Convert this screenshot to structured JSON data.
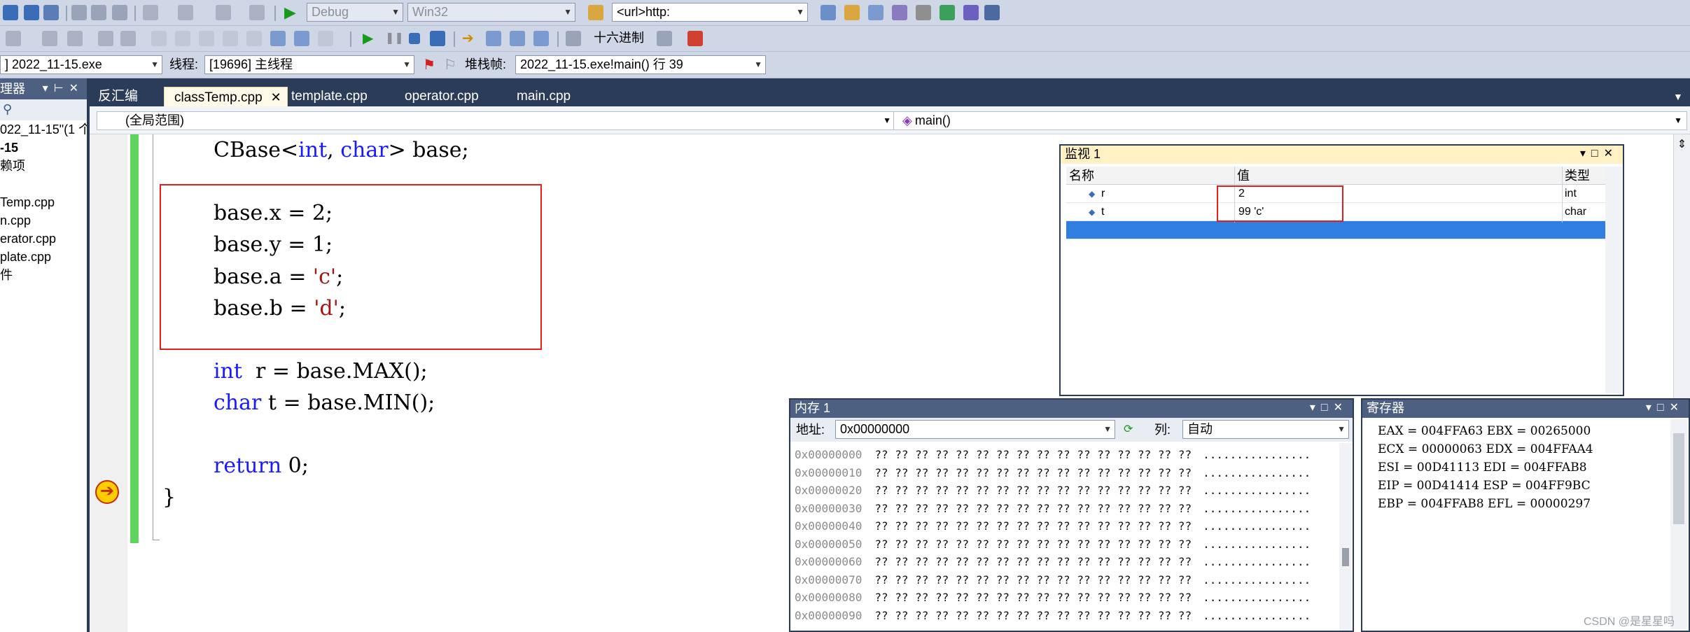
{
  "toolbar1": {
    "config": "Debug",
    "platform": "Win32",
    "url": "<url>http:"
  },
  "toolbar2": {
    "hex_label": "十六进制"
  },
  "toolbar3": {
    "process": "] 2022_11-15.exe",
    "thread_label": "线程:",
    "thread": "[19696] 主线程",
    "stack_label": "堆栈帧:",
    "stack_frame": "2022_11-15.exe!main() 行 39"
  },
  "solution": {
    "title": "理器",
    "items": [
      "022_11-15\"(1 个",
      "-15",
      "赖项",
      "",
      "Temp.cpp",
      "n.cpp",
      "erator.cpp",
      "plate.cpp",
      "件"
    ]
  },
  "tabs": [
    "反汇编",
    "classTemp.cpp",
    "template.cpp",
    "operator.cpp",
    "main.cpp"
  ],
  "navbar": {
    "scope": "(全局范围)",
    "function": "main()"
  },
  "code": {
    "l1_a": "CBase<",
    "l1_kw1": "int",
    "l1_b": ", ",
    "l1_kw2": "char",
    "l1_c": "> base;",
    "l2": "base.x = 2;",
    "l3": "base.y = 1;",
    "l4_a": "base.a = ",
    "l4_s": "'c'",
    "l4_b": ";",
    "l5_a": "base.b = ",
    "l5_s": "'d'",
    "l5_b": ";",
    "l6_kw": "int",
    "l6_b": "  r = base.MAX();",
    "l7_kw": "char",
    "l7_b": " t = base.MIN();",
    "l8_kw": "return",
    "l8_b": " 0;",
    "l9": "}"
  },
  "watch": {
    "title": "监视 1",
    "col_name": "名称",
    "col_value": "值",
    "col_type": "类型",
    "rows": [
      {
        "name": "r",
        "value": "2",
        "type": "int"
      },
      {
        "name": "t",
        "value": "99 'c'",
        "type": "char"
      }
    ]
  },
  "memory": {
    "title": "内存 1",
    "addr_label": "地址:",
    "addr": "0x00000000",
    "col_label": "列:",
    "col_value": "自动",
    "bytes": "?? ?? ?? ?? ?? ?? ?? ?? ?? ?? ?? ?? ?? ?? ?? ??",
    "chars": "................",
    "addresses": [
      "0x00000000",
      "0x00000010",
      "0x00000020",
      "0x00000030",
      "0x00000040",
      "0x00000050",
      "0x00000060",
      "0x00000070",
      "0x00000080",
      "0x00000090"
    ]
  },
  "registers": {
    "title": "寄存器",
    "lines": [
      "EAX = 004FFA63 EBX = 00265000",
      "ECX = 00000063 EDX = 004FFAA4",
      "ESI = 00D41113 EDI = 004FFAB8",
      "EIP = 00D41414 ESP = 004FF9BC",
      "EBP = 004FFAB8 EFL = 00000297"
    ]
  },
  "watermark": "CSDN @是星星吗",
  "colors": {
    "accent": "#2b3c59",
    "highlight_box": "#e02020",
    "keyword": "#1a1aff",
    "string": "#a31515"
  }
}
